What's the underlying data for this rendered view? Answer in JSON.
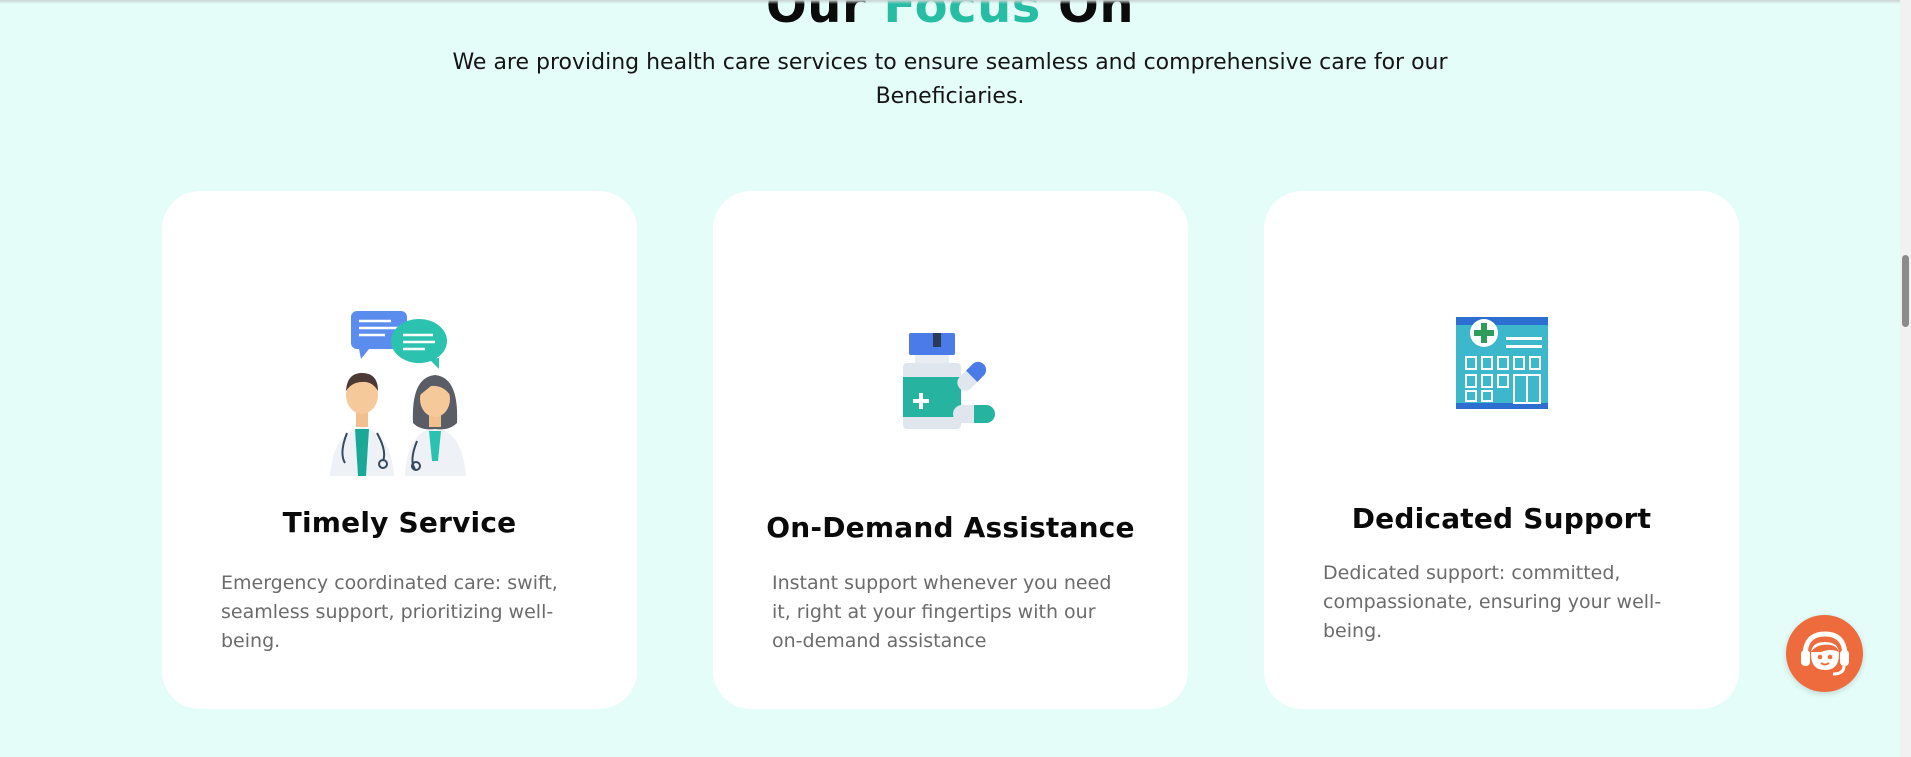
{
  "section": {
    "heading_part1": "Our ",
    "heading_accent": "Focus",
    "heading_part3": " On",
    "subtitle": "We are providing  health care services to ensure seamless and comprehensive care for our Beneficiaries."
  },
  "cards": [
    {
      "icon": "doctors-chat-icon",
      "title": "Timely Service",
      "description": "Emergency coordinated care: swift, seamless support, prioritizing well-being."
    },
    {
      "icon": "medicine-pills-icon",
      "title": "On-Demand Assistance",
      "description": "Instant support whenever you need it, right at your fingertips with our on-demand assistance"
    },
    {
      "icon": "hospital-building-icon",
      "title": "Dedicated Support",
      "description": "Dedicated support: committed, compassionate, ensuring your well-being."
    }
  ],
  "chat_widget": {
    "icon": "support-agent-icon"
  },
  "colors": {
    "background": "#e4fdf9",
    "accent": "#27bca4",
    "card": "#ffffff",
    "chat_button": "#ee6b3d"
  }
}
